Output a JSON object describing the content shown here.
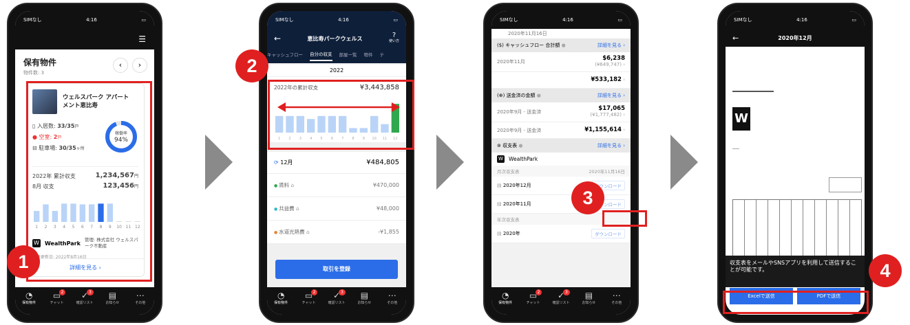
{
  "common": {
    "time": "4:16",
    "carrier": "SIMなし",
    "tabs": [
      {
        "label": "保有物件",
        "icon": "◔"
      },
      {
        "label": "チャット",
        "icon": "▭",
        "badge": "2"
      },
      {
        "label": "確認リスト",
        "icon": "✓",
        "badge": "3"
      },
      {
        "label": "お知らせ",
        "icon": "▤"
      },
      {
        "label": "その他",
        "icon": "⋯"
      }
    ]
  },
  "steps": [
    "1",
    "2",
    "3",
    "4"
  ],
  "screen1": {
    "title": "保有物件",
    "count": "物件数: 3",
    "property_name": "ウェルスパーク アパートメント恵比寿",
    "occupancy_label": "入居数:",
    "occupancy_value": "33/35",
    "occupancy_unit": "戸",
    "vacancy_label": "空室:",
    "vacancy_value": "2",
    "vacancy_unit": "戸",
    "parking_label": "駐車場:",
    "parking_value": "30/35",
    "parking_unit": "ヶ所",
    "gauge_label": "稼働率",
    "gauge_value": "94%",
    "gauge_fraction": 0.94,
    "year_label": "2022年 累計収支",
    "year_value": "1,234,567",
    "month_label": "8月 収支",
    "month_value": "123,456",
    "yen": "円",
    "chart_data": {
      "type": "bar",
      "categories": [
        "1",
        "2",
        "3",
        "4",
        "5",
        "6",
        "7",
        "8",
        "9",
        "10",
        "11",
        "12"
      ],
      "values": [
        30,
        48,
        30,
        50,
        50,
        48,
        48,
        50,
        50,
        0,
        0,
        0
      ],
      "highlight_index": 7
    },
    "brand": "WealthPark",
    "manager": "管理: 株式会社 ウェルスパーク不動産",
    "updated": "最終更新日: 2022年8月16日",
    "detail_button": "詳細を見る"
  },
  "screen2": {
    "title": "恵比寿パークウェルス",
    "help": "使い方",
    "tabs": [
      "キャッシュフロー",
      "自分の収支",
      "部屋一覧",
      "物件",
      "テ"
    ],
    "active_tab": 1,
    "year": "2022",
    "cumulative_label": "2022年の累計収支",
    "cumulative_value": "¥3,443,858",
    "chart_data": {
      "type": "bar",
      "categories": [
        "1",
        "2",
        "3",
        "4",
        "5",
        "6",
        "7",
        "8",
        "9",
        "10",
        "11",
        "12"
      ],
      "values": [
        55,
        55,
        55,
        45,
        55,
        55,
        55,
        15,
        15,
        55,
        28,
        95
      ]
    },
    "month": "12月",
    "month_value": "¥484,805",
    "items": [
      {
        "label": "賃料",
        "value": "¥470,000",
        "color": "#2fa84f"
      },
      {
        "label": "共益費",
        "value": "¥48,000",
        "color": "#2fb9c9"
      },
      {
        "label": "水道光熱費",
        "value": "-¥1,855",
        "color": "#e8842c"
      }
    ],
    "register_button": "取引を登録"
  },
  "screen3": {
    "top_date": "2020年11月16日",
    "sections": [
      {
        "title": "キャッシュフロー 合計額",
        "link": "詳細を見る"
      },
      {
        "title": "送金済の金額",
        "link": "詳細を見る"
      },
      {
        "title": "収支表",
        "link": "詳細を見る"
      }
    ],
    "cf_rows": [
      {
        "label": "2020年11月",
        "value": "$6,238",
        "sub": "(¥649,747)"
      },
      {
        "label": "",
        "value": "¥533,182",
        "sub": ""
      }
    ],
    "remit_rows": [
      {
        "label": "2020年9月 - 送金済",
        "value": "$17,065",
        "sub": "(¥1,777,482)"
      },
      {
        "label": "2020年9月 - 送金済",
        "value": "¥1,155,614",
        "sub": ""
      }
    ],
    "brand": "WealthPark",
    "monthly_label": "月次収支表",
    "monthly_date": "2020年11月16日",
    "download": "ダウンロード",
    "monthly_rows": [
      "2020年12月",
      "2020年11月"
    ],
    "yearly_label": "年次収支表",
    "yearly_rows": [
      "2020年"
    ]
  },
  "screen4": {
    "title": "2020年12月",
    "message": "収支表をメールやSNSアプリを利用して送信することが可能です。",
    "excel_button": "Excelで送信",
    "pdf_button": "PDFで送信"
  }
}
